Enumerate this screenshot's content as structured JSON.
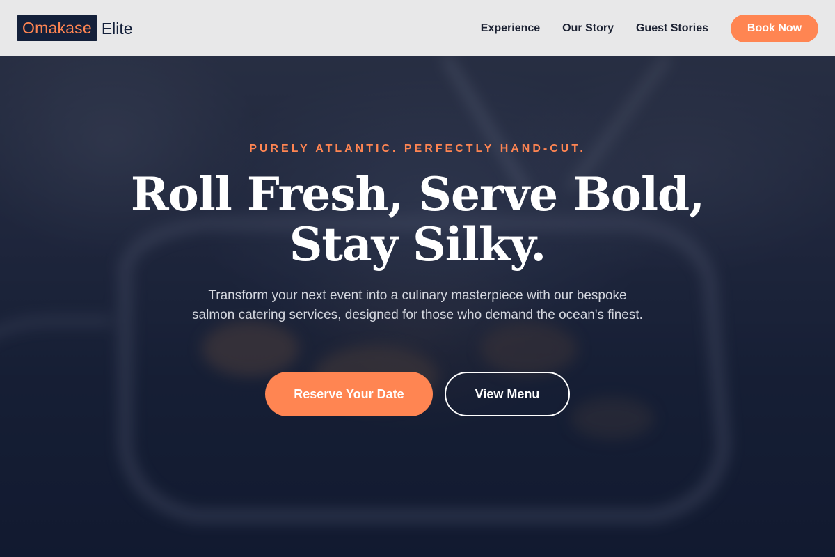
{
  "header": {
    "logo_highlight": "Omakase",
    "logo_rest": "Elite",
    "nav": [
      {
        "label": "Experience"
      },
      {
        "label": "Our Story"
      },
      {
        "label": "Guest Stories"
      }
    ],
    "book_label": "Book Now"
  },
  "hero": {
    "tagline": "PURELY ATLANTIC. PERFECTLY HAND-CUT.",
    "headline_line1": "Roll Fresh, Serve Bold,",
    "headline_line2": "Stay Silky.",
    "subtext": "Transform your next event into a culinary masterpiece with our bespoke salmon catering services, designed for those who demand the ocean's finest.",
    "cta_primary": "Reserve Your Date",
    "cta_secondary": "View Menu"
  },
  "colors": {
    "accent": "#ff8552",
    "navy": "#14203a",
    "header_bg": "#e8e8e9"
  }
}
